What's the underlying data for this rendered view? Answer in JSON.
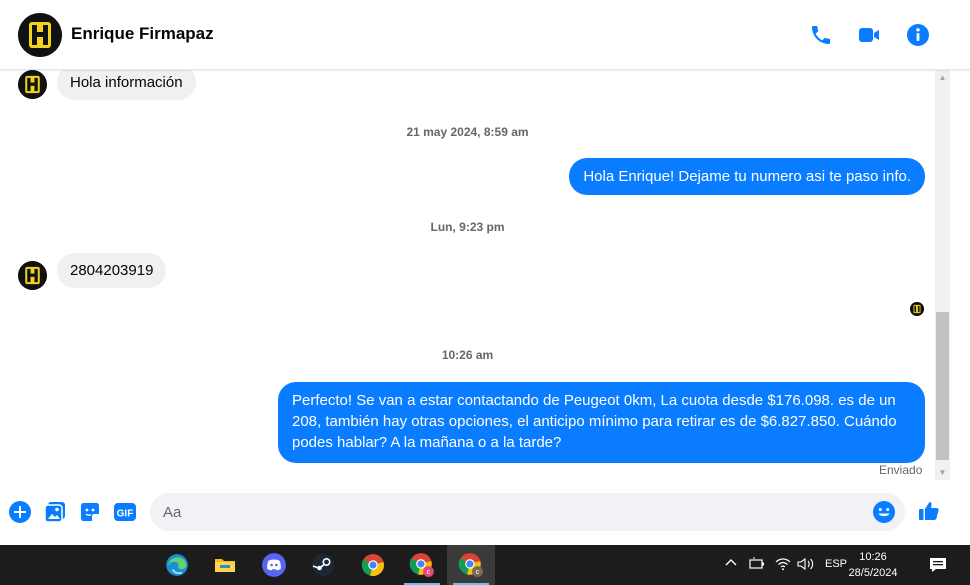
{
  "header": {
    "contact_name": "Enrique Firmapaz"
  },
  "messages": {
    "first_incoming": "Hola información",
    "timestamp_1": "21 may 2024, 8:59 am",
    "outgoing_1": "Hola Enrique! Dejame tu numero asi te paso info.",
    "timestamp_2": "Lun, 9:23 pm",
    "incoming_2": "2804203919",
    "timestamp_3": "10:26 am",
    "outgoing_2": "Perfecto!  Se van a estar contactando de Peugeot 0km, La cuota desde $176.098. es de un 208, también hay otras opciones, el anticipo mínimo para retirar es de $6.827.850. Cuándo podes hablar? A la mañana o a la tarde?",
    "status": "Enviado"
  },
  "composer": {
    "placeholder": "Aa"
  },
  "taskbar": {
    "apps": [
      "Microsoft Edge",
      "File Explorer",
      "Discord",
      "Steam",
      "Google Chrome",
      "Google Chrome (profile C)",
      "Google Chrome (profile C)"
    ],
    "language": "ESP",
    "time": "10:26",
    "date": "28/5/2024"
  },
  "colors": {
    "accent": "#0a7cff",
    "incoming_bubble": "#f0f0f0",
    "taskbar": "#1c1c1c",
    "avatar_yellow": "#f2d21b"
  }
}
